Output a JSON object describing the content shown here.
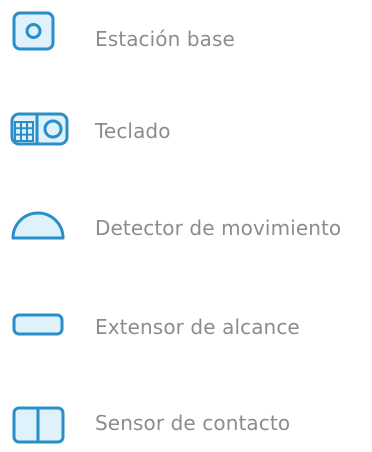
{
  "colors": {
    "icon_stroke": "#2a8fc9",
    "icon_fill": "#dff1fb",
    "label_text": "#8a8d90",
    "background": "#ffffff"
  },
  "legend": {
    "items": [
      {
        "icon": "base-station-icon",
        "label": "Estación base"
      },
      {
        "icon": "keypad-icon",
        "label": "Teclado"
      },
      {
        "icon": "motion-detector-icon",
        "label": "Detector de movimiento"
      },
      {
        "icon": "range-extender-icon",
        "label": "Extensor de alcance"
      },
      {
        "icon": "contact-sensor-icon",
        "label": "Sensor de contacto"
      }
    ]
  }
}
